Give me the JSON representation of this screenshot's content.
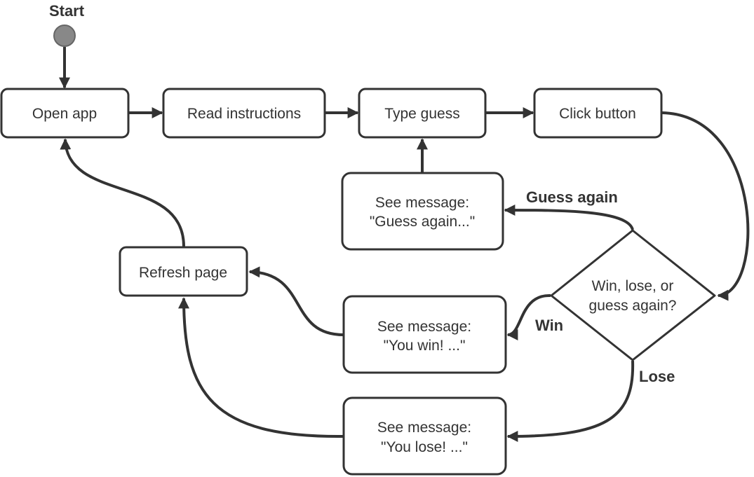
{
  "start": {
    "label": "Start",
    "color": "#888888"
  },
  "nodes": {
    "open_app": "Open app",
    "read_instructions": "Read instructions",
    "type_guess": "Type guess",
    "click_button": "Click button",
    "guess_again_msg": [
      "See message:",
      "\"Guess again...\""
    ],
    "decision": [
      "Win, lose, or",
      "guess again?"
    ],
    "refresh_page": "Refresh page",
    "win_msg": [
      "See message:",
      "\"You win! ...\""
    ],
    "lose_msg": [
      "See message:",
      "\"You lose! ...\""
    ]
  },
  "edge_labels": {
    "guess_again": "Guess again",
    "win": "Win",
    "lose": "Lose"
  }
}
